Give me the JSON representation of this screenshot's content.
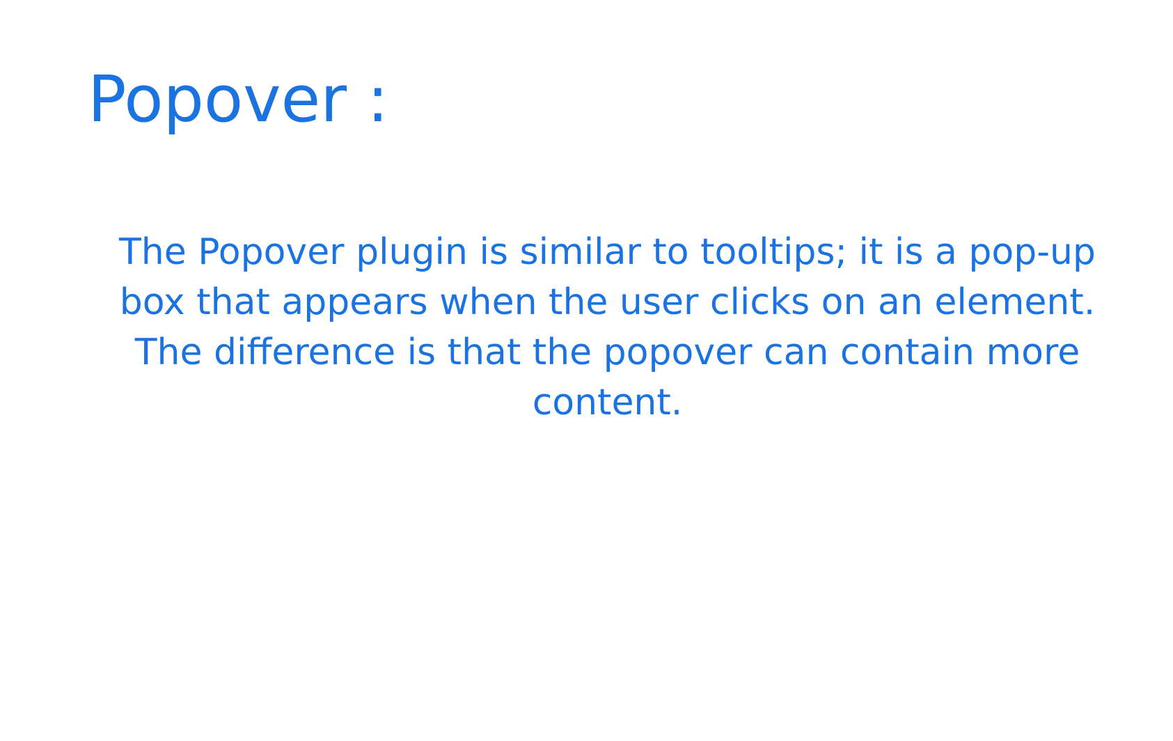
{
  "slide": {
    "title": "Popover :",
    "body": "The Popover plugin is similar to tooltips; it is a pop-up box that appears when the user clicks on an element. The difference is that the popover can contain more content."
  },
  "colors": {
    "text": "#1a73e0",
    "background": "#ffffff"
  }
}
